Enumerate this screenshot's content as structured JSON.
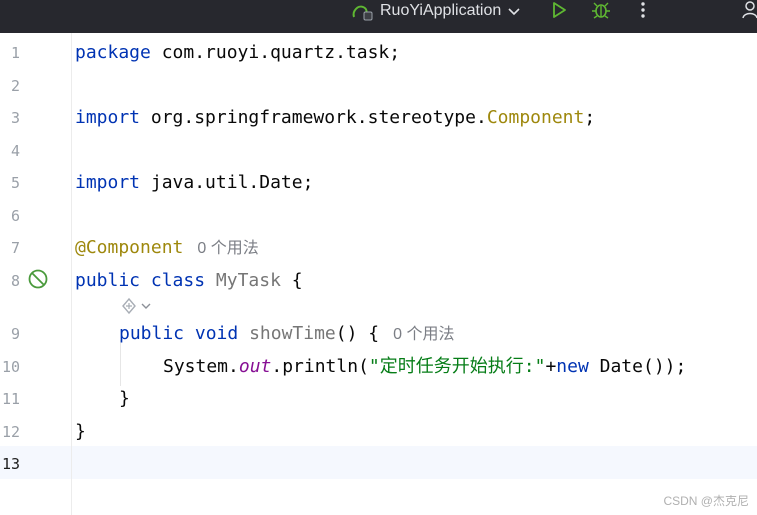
{
  "toolbar": {
    "run_config_label": "RuoYiApplication",
    "icons": [
      "app-config-icon",
      "chevron-down-icon",
      "run-icon",
      "debug-icon",
      "more-vert-icon",
      "user-icon"
    ]
  },
  "editor": {
    "line_numbers": [
      "1",
      "2",
      "3",
      "4",
      "5",
      "6",
      "7",
      "8",
      "9",
      "10",
      "11",
      "12",
      "13"
    ],
    "current_line": "13",
    "lines": {
      "l1": {
        "kw": "package",
        "text": " com.ruoyi.quartz.task;"
      },
      "l3": {
        "kw": "import",
        "text_a": " org.springframework.stereotype.",
        "cls": "Component",
        "text_b": ";"
      },
      "l5": {
        "kw": "import",
        "text": " java.util.Date;"
      },
      "l7": {
        "ann": "@Component",
        "hint": "0 个用法"
      },
      "l8": {
        "kw1": "public",
        "kw2": "class",
        "cls": "MyTask",
        "text": " {"
      },
      "l9": {
        "kw1": "public",
        "kw2": "void",
        "method": "showTime",
        "text": "() {",
        "hint": "0 个用法"
      },
      "l10": {
        "a": "System.",
        "field": "out",
        "b": ".println(",
        "str": "\"定时任务开始执行:\"",
        "c": "+",
        "kw": "new",
        "d": " Date());"
      },
      "l11": {
        "text": "}"
      },
      "l12": {
        "text": "}"
      }
    },
    "gutter_icon": "no-run-icon",
    "inlay_icon": "ai-assist-icon"
  },
  "watermark": "CSDN @杰克尼",
  "colors": {
    "toolbar_bg": "#27282e",
    "keyword": "#0033b3",
    "annotation": "#9e880d",
    "class_name": "#767676",
    "field": "#871094",
    "string": "#067d17",
    "current_line": "#f5f8fe"
  }
}
